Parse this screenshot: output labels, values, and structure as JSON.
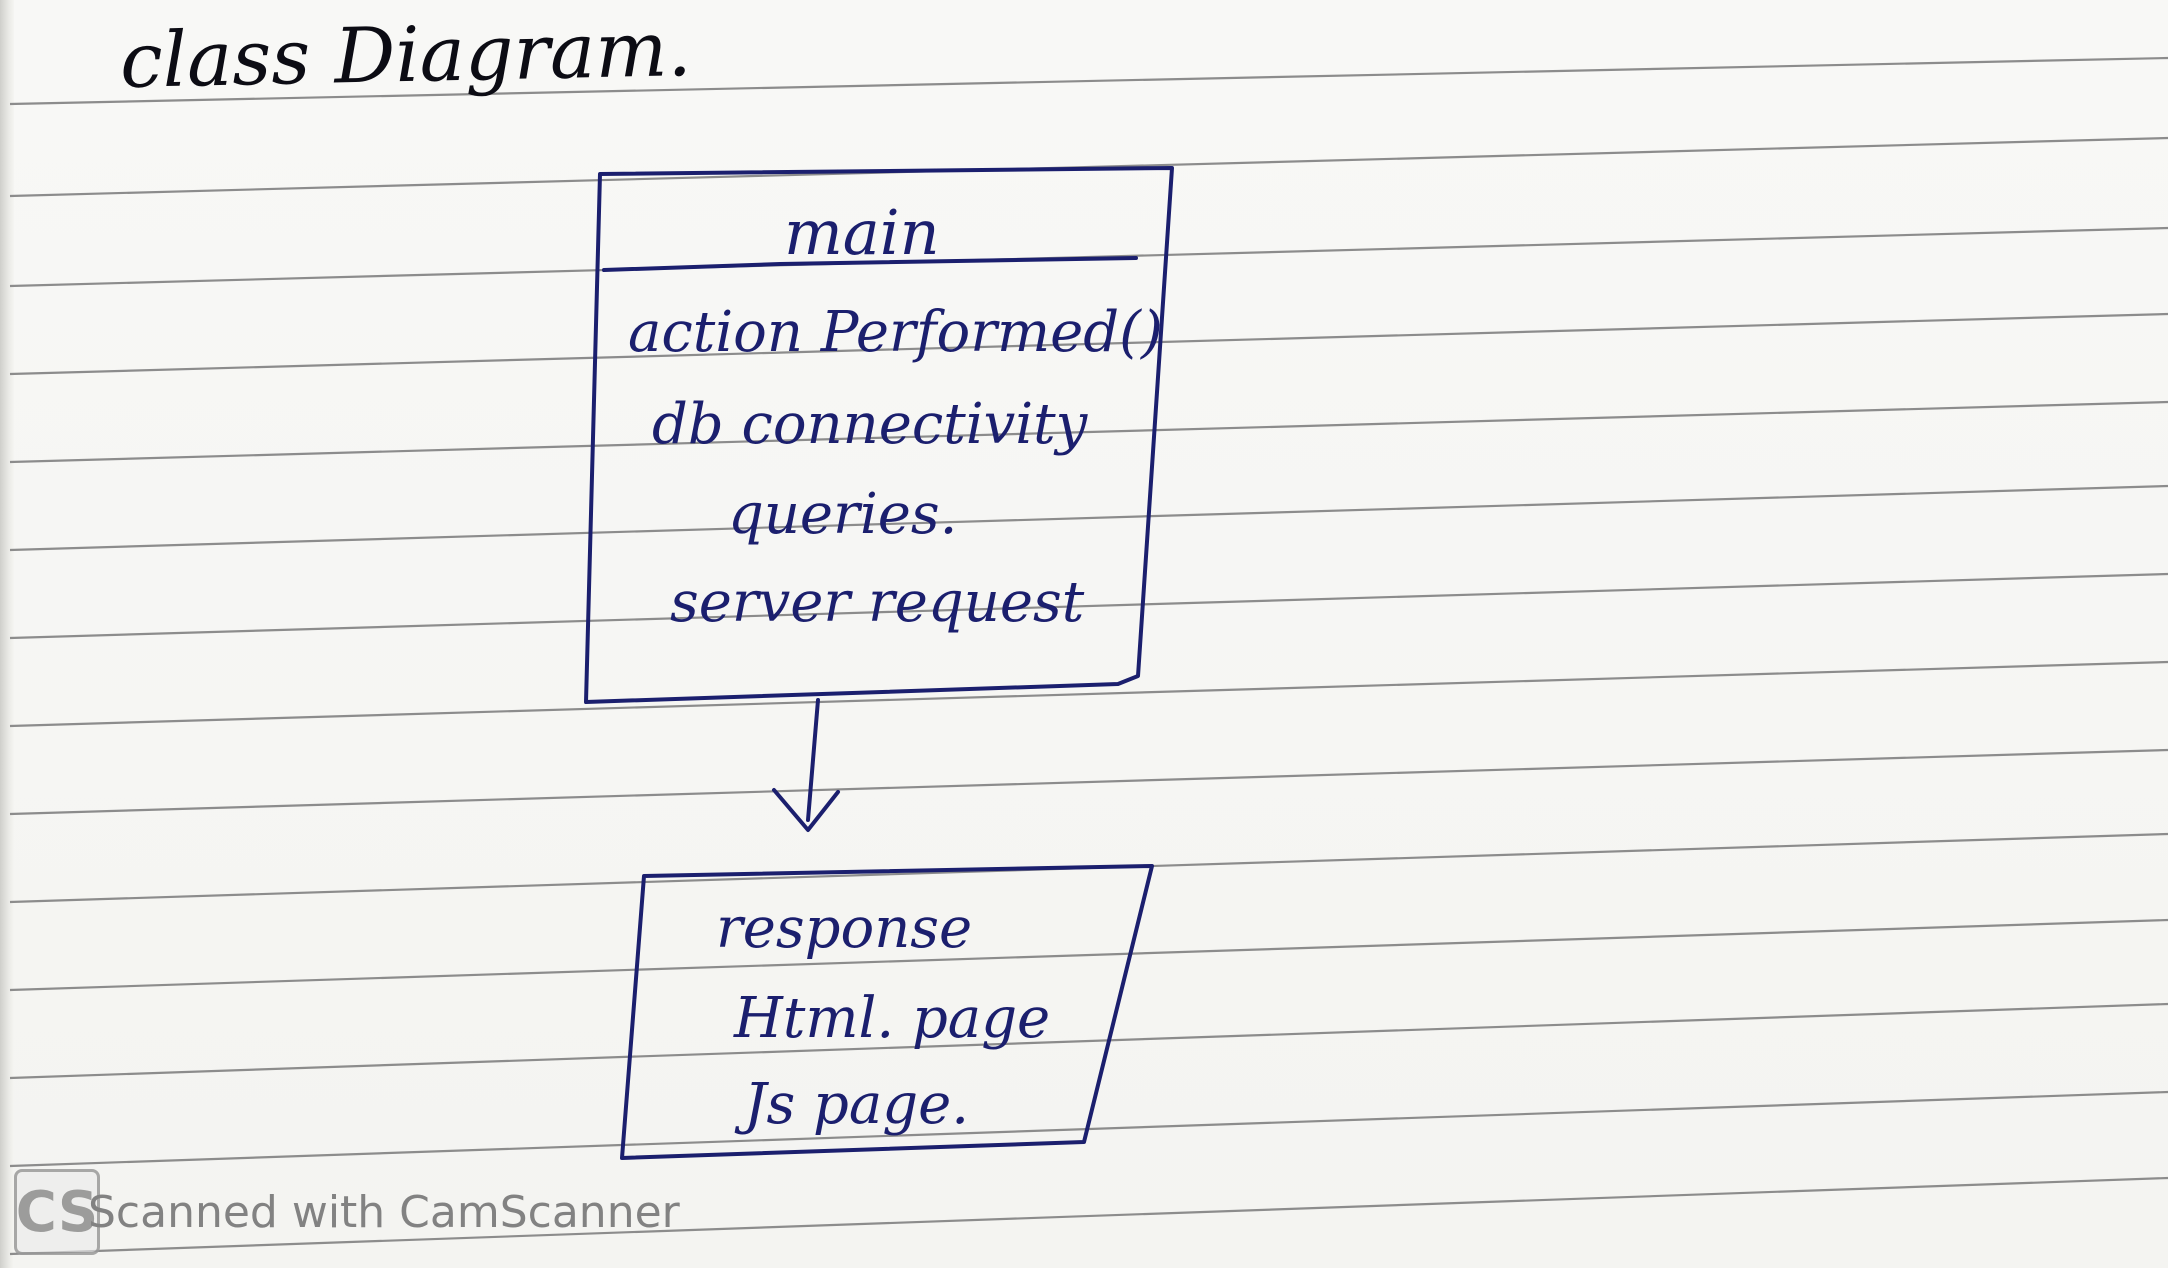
{
  "title": "class Diagram.",
  "boxes": {
    "main": {
      "name": "main",
      "items": [
        "action Performed()",
        "db connectivity",
        "queries.",
        "server request"
      ]
    },
    "response": {
      "items": [
        "response",
        "Html. page",
        "Js page."
      ]
    }
  },
  "watermark": {
    "badge": "CS",
    "text": "Scanned with CamScanner"
  },
  "colors": {
    "ink": "#1b1f6e",
    "title_ink": "#0c0c14",
    "rule": "#8a8a8a"
  }
}
